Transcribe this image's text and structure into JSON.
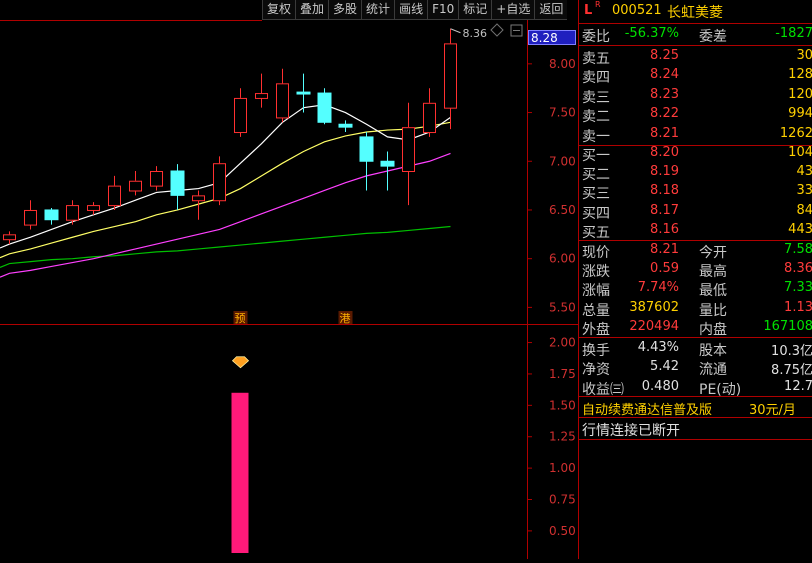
{
  "toolbar": {
    "items": [
      "复权",
      "叠加",
      "多股",
      "统计",
      "画线",
      "F10",
      "标记",
      "+自选",
      "返回"
    ]
  },
  "chart": {
    "current_price_tag": "8.28",
    "high_marker": "8.36",
    "markers": [
      "预",
      "港"
    ],
    "main_y_ticks": [
      "8.00",
      "7.50",
      "7.00",
      "6.50",
      "6.00",
      "5.50"
    ],
    "sub_y_ticks": [
      "2.00",
      "1.75",
      "1.50",
      "1.25",
      "1.00",
      "0.75",
      "0.50"
    ],
    "colors": {
      "up": "#ff3030",
      "down": "#54ffff",
      "ma5": "#ffffff",
      "ma10": "#ffff66",
      "ma20": "#ff40ff",
      "ma60": "#00c000",
      "indicator": "#ff1a7a"
    }
  },
  "chart_data": {
    "type": "candlestick",
    "candles": [
      {
        "o": 6.2,
        "c": 6.25,
        "h": 6.28,
        "l": 6.15,
        "dir": "up"
      },
      {
        "o": 6.35,
        "c": 6.5,
        "h": 6.6,
        "l": 6.3,
        "dir": "up"
      },
      {
        "o": 6.5,
        "c": 6.4,
        "h": 6.52,
        "l": 6.35,
        "dir": "down"
      },
      {
        "o": 6.4,
        "c": 6.55,
        "h": 6.6,
        "l": 6.35,
        "dir": "up"
      },
      {
        "o": 6.5,
        "c": 6.55,
        "h": 6.58,
        "l": 6.45,
        "dir": "up"
      },
      {
        "o": 6.55,
        "c": 6.75,
        "h": 6.85,
        "l": 6.5,
        "dir": "up"
      },
      {
        "o": 6.7,
        "c": 6.8,
        "h": 6.9,
        "l": 6.65,
        "dir": "up"
      },
      {
        "o": 6.75,
        "c": 6.9,
        "h": 6.95,
        "l": 6.7,
        "dir": "up"
      },
      {
        "o": 6.9,
        "c": 6.65,
        "h": 6.97,
        "l": 6.5,
        "dir": "down"
      },
      {
        "o": 6.6,
        "c": 6.65,
        "h": 6.7,
        "l": 6.4,
        "dir": "up"
      },
      {
        "o": 6.6,
        "c": 6.98,
        "h": 7.05,
        "l": 6.55,
        "dir": "up"
      },
      {
        "o": 7.3,
        "c": 7.65,
        "h": 7.75,
        "l": 7.25,
        "dir": "up"
      },
      {
        "o": 7.65,
        "c": 7.7,
        "h": 7.9,
        "l": 7.55,
        "dir": "up"
      },
      {
        "o": 7.45,
        "c": 7.8,
        "h": 7.95,
        "l": 7.4,
        "dir": "up"
      },
      {
        "o": 7.71,
        "c": 7.69,
        "h": 7.9,
        "l": 7.5,
        "dir": "down"
      },
      {
        "o": 7.7,
        "c": 7.4,
        "h": 7.75,
        "l": 7.38,
        "dir": "down"
      },
      {
        "o": 7.38,
        "c": 7.35,
        "h": 7.42,
        "l": 7.3,
        "dir": "down"
      },
      {
        "o": 7.25,
        "c": 7.0,
        "h": 7.3,
        "l": 6.7,
        "dir": "down"
      },
      {
        "o": 7.0,
        "c": 6.95,
        "h": 7.1,
        "l": 6.7,
        "dir": "down"
      },
      {
        "o": 6.9,
        "c": 7.35,
        "h": 7.6,
        "l": 6.55,
        "dir": "up"
      },
      {
        "o": 7.3,
        "c": 7.6,
        "h": 7.75,
        "l": 7.25,
        "dir": "up"
      },
      {
        "o": 7.55,
        "c": 8.21,
        "h": 8.36,
        "l": 7.33,
        "dir": "up"
      }
    ],
    "ma5": [
      6.15,
      6.22,
      6.3,
      6.38,
      6.45,
      6.52,
      6.6,
      6.68,
      6.7,
      6.72,
      6.78,
      6.98,
      7.18,
      7.4,
      7.55,
      7.58,
      7.5,
      7.38,
      7.25,
      7.22,
      7.3,
      7.45
    ],
    "ma10": [
      6.05,
      6.1,
      6.16,
      6.22,
      6.28,
      6.33,
      6.38,
      6.45,
      6.5,
      6.56,
      6.62,
      6.72,
      6.85,
      6.98,
      7.1,
      7.2,
      7.26,
      7.3,
      7.32,
      7.33,
      7.36,
      7.4
    ],
    "ma20": [
      5.85,
      5.88,
      5.92,
      5.96,
      6.0,
      6.05,
      6.1,
      6.15,
      6.2,
      6.25,
      6.3,
      6.38,
      6.46,
      6.54,
      6.62,
      6.7,
      6.78,
      6.85,
      6.9,
      6.95,
      7.0,
      7.08
    ],
    "ma60": [
      5.95,
      5.97,
      5.99,
      6.0,
      6.02,
      6.03,
      6.05,
      6.07,
      6.08,
      6.1,
      6.12,
      6.14,
      6.16,
      6.18,
      6.2,
      6.22,
      6.24,
      6.26,
      6.27,
      6.29,
      6.31,
      6.33
    ],
    "indicator_bar": {
      "index": 11,
      "value": 1.6
    },
    "ylim_main": [
      5.35,
      8.45
    ],
    "ylim_sub": [
      0.3,
      2.1
    ]
  },
  "quote": {
    "code": "000521",
    "name": "长虹美菱",
    "ratio_label": "委比",
    "ratio_value": "-56.37%",
    "diff_label": "委差",
    "diff_value": "-1827",
    "asks": [
      {
        "label": "卖五",
        "price": "8.25",
        "vol": "30"
      },
      {
        "label": "卖四",
        "price": "8.24",
        "vol": "128"
      },
      {
        "label": "卖三",
        "price": "8.23",
        "vol": "120"
      },
      {
        "label": "卖二",
        "price": "8.22",
        "vol": "994"
      },
      {
        "label": "卖一",
        "price": "8.21",
        "vol": "1262"
      }
    ],
    "bids": [
      {
        "label": "买一",
        "price": "8.20",
        "vol": "104"
      },
      {
        "label": "买二",
        "price": "8.19",
        "vol": "43"
      },
      {
        "label": "买三",
        "price": "8.18",
        "vol": "33"
      },
      {
        "label": "买四",
        "price": "8.17",
        "vol": "84"
      },
      {
        "label": "买五",
        "price": "8.16",
        "vol": "443"
      }
    ],
    "stats": [
      {
        "l1": "现价",
        "v1": "8.21",
        "c1": "red",
        "l2": "今开",
        "v2": "7.58",
        "c2": "green"
      },
      {
        "l1": "涨跌",
        "v1": "0.59",
        "c1": "red",
        "l2": "最高",
        "v2": "8.36",
        "c2": "red"
      },
      {
        "l1": "涨幅",
        "v1": "7.74%",
        "c1": "red",
        "l2": "最低",
        "v2": "7.33",
        "c2": "green"
      },
      {
        "l1": "总量",
        "v1": "387602",
        "c1": "yellow",
        "l2": "量比",
        "v2": "1.13",
        "c2": "red"
      },
      {
        "l1": "外盘",
        "v1": "220494",
        "c1": "red",
        "l2": "内盘",
        "v2": "167108",
        "c2": "green"
      }
    ],
    "fin": [
      {
        "l1": "换手",
        "v1": "4.43%",
        "l2": "股本",
        "v2": "10.3亿"
      },
      {
        "l1": "净资",
        "v1": "5.42",
        "l2": "流通",
        "v2": "8.75亿"
      },
      {
        "l1": "收益㈢",
        "v1": "0.480",
        "l2": "PE(动)",
        "v2": "12.7"
      }
    ],
    "ad_text": "自动续费通达信普及版",
    "ad_price": "30元/月",
    "status_text": "行情连接已断开"
  }
}
